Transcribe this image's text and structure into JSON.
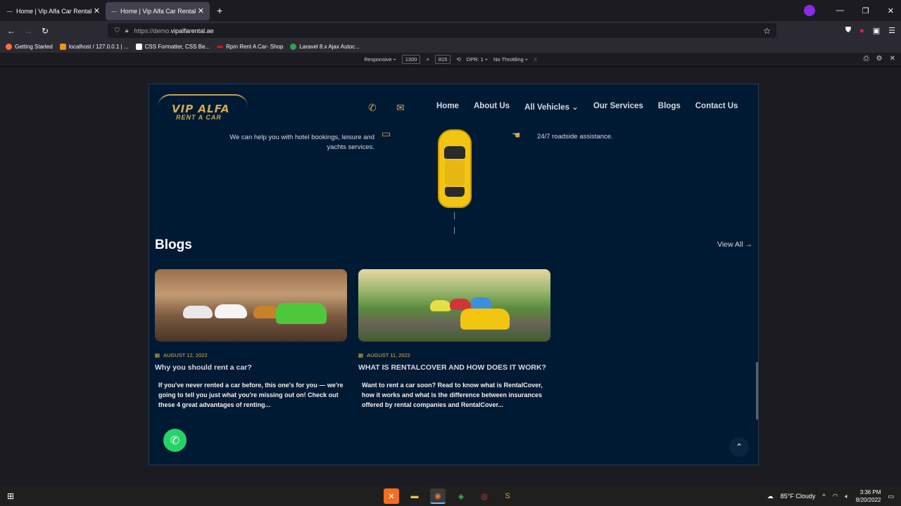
{
  "browser": {
    "tabs": [
      {
        "title": "Home | Vip Alfa Car Rental"
      },
      {
        "title": "Home | Vip Alfa Car Rental"
      }
    ],
    "url_prefix": "https://demo.",
    "url_host": "vipalfarental.ae",
    "bookmarks": [
      {
        "label": "Getting Started",
        "color": "#ff7139"
      },
      {
        "label": "localhost / 127.0.0.1 | ...",
        "color": "#f29111"
      },
      {
        "label": "CSS Formatter, CSS Be...",
        "color": "#ffffff"
      },
      {
        "label": "Rpm Rent A Car- Shop",
        "color": "#d01a1a"
      },
      {
        "label": "Laravel 8.x Ajax Autoc...",
        "color": "#30a14e"
      }
    ]
  },
  "rdm": {
    "device": "Responsive ÷",
    "width": "1300",
    "times": "×",
    "height": "815",
    "dpr": "DPR: 1 ÷",
    "throttle": "No Throttling ÷"
  },
  "site": {
    "logo_name": "VIP ALFA",
    "logo_sub": "RENT A CAR",
    "menu": [
      "Home",
      "About Us",
      "All Vehicles ⌄",
      "Our Services",
      "Blogs",
      "Contact Us"
    ],
    "feature_left": "We can help you with hotel bookings, leisure and yachts services.",
    "feature_right": "24/7 roadside assistance.",
    "blogs_title": "Blogs",
    "view_all": "View All →",
    "posts": [
      {
        "date": "AUGUST 12, 2022",
        "title": "Why you should rent a car?",
        "excerpt": "If you've never rented a car before, this one's for you — we're going to tell you just what you're missing out on! Check out these 4 great advantages of renting..."
      },
      {
        "date": "AUGUST 11, 2022",
        "title": "WHAT IS RENTALCOVER AND HOW DOES IT WORK?",
        "excerpt": "Want to rent a car soon? Read to know what is RentalCover, how it works and what is the difference between insurances offered by rental companies and RentalCover..."
      }
    ]
  },
  "taskbar": {
    "weather": "85°F  Cloudy",
    "time": "3:36 PM",
    "date": "8/20/2022"
  }
}
